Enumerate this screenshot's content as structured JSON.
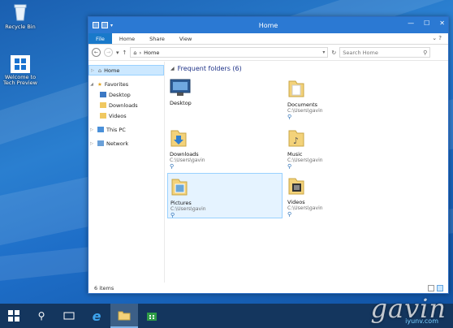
{
  "desktop": {
    "icons": [
      {
        "label": "Recycle Bin",
        "icon": "recycle-bin-icon"
      },
      {
        "label": "Welcome to Tech Preview",
        "icon": "windows-logo-icon"
      }
    ]
  },
  "window": {
    "title": "Home",
    "ribbon_tabs": [
      "File",
      "Home",
      "Share",
      "View"
    ],
    "address": {
      "path": "Home",
      "dropdown": "▾"
    },
    "search": {
      "placeholder": "Search Home"
    },
    "nav_pane": {
      "items": [
        {
          "label": "Home",
          "icon": "home-icon",
          "level": 0,
          "selected": true
        },
        {
          "label": "Favorites",
          "icon": "star-icon",
          "level": 0
        },
        {
          "label": "Desktop",
          "icon": "desktop-icon",
          "level": 1
        },
        {
          "label": "Downloads",
          "icon": "downloads-icon",
          "level": 1
        },
        {
          "label": "Videos",
          "icon": "videos-icon",
          "level": 1
        },
        {
          "label": "This PC",
          "icon": "computer-icon",
          "level": 0
        },
        {
          "label": "Network",
          "icon": "network-icon",
          "level": 0
        }
      ]
    },
    "content": {
      "group_header": "Frequent folders (6)",
      "folders": [
        {
          "name": "Desktop",
          "path": "",
          "icon": "desktop-folder-icon",
          "pinned": false
        },
        {
          "name": "Documents",
          "path": "C:\\Users\\gavin",
          "icon": "documents-folder-icon",
          "pinned": true
        },
        {
          "name": "Downloads",
          "path": "C:\\Users\\gavin",
          "icon": "downloads-folder-icon",
          "pinned": true
        },
        {
          "name": "Music",
          "path": "C:\\Users\\gavin",
          "icon": "music-folder-icon",
          "pinned": true
        },
        {
          "name": "Pictures",
          "path": "C:\\Users\\gavin",
          "icon": "pictures-folder-icon",
          "pinned": true,
          "selected": true
        },
        {
          "name": "Videos",
          "path": "C:\\Users\\gavin",
          "icon": "videos-folder-icon",
          "pinned": true
        }
      ]
    },
    "status": {
      "item_count": "6 items"
    }
  },
  "taskbar": {
    "buttons": [
      {
        "name": "start",
        "icon": "windows-logo-icon"
      },
      {
        "name": "search",
        "icon": "search-icon"
      },
      {
        "name": "task-view",
        "icon": "task-view-icon"
      },
      {
        "name": "internet-explorer",
        "icon": "ie-icon"
      },
      {
        "name": "file-explorer",
        "icon": "folder-icon",
        "active": true
      },
      {
        "name": "store",
        "icon": "store-icon"
      }
    ]
  },
  "watermark": {
    "text": "gavin",
    "subtext": "iyunv.com"
  },
  "colors": {
    "accent": "#2b79d3",
    "selection": "#cce8ff",
    "folder": "#f3d27a"
  }
}
